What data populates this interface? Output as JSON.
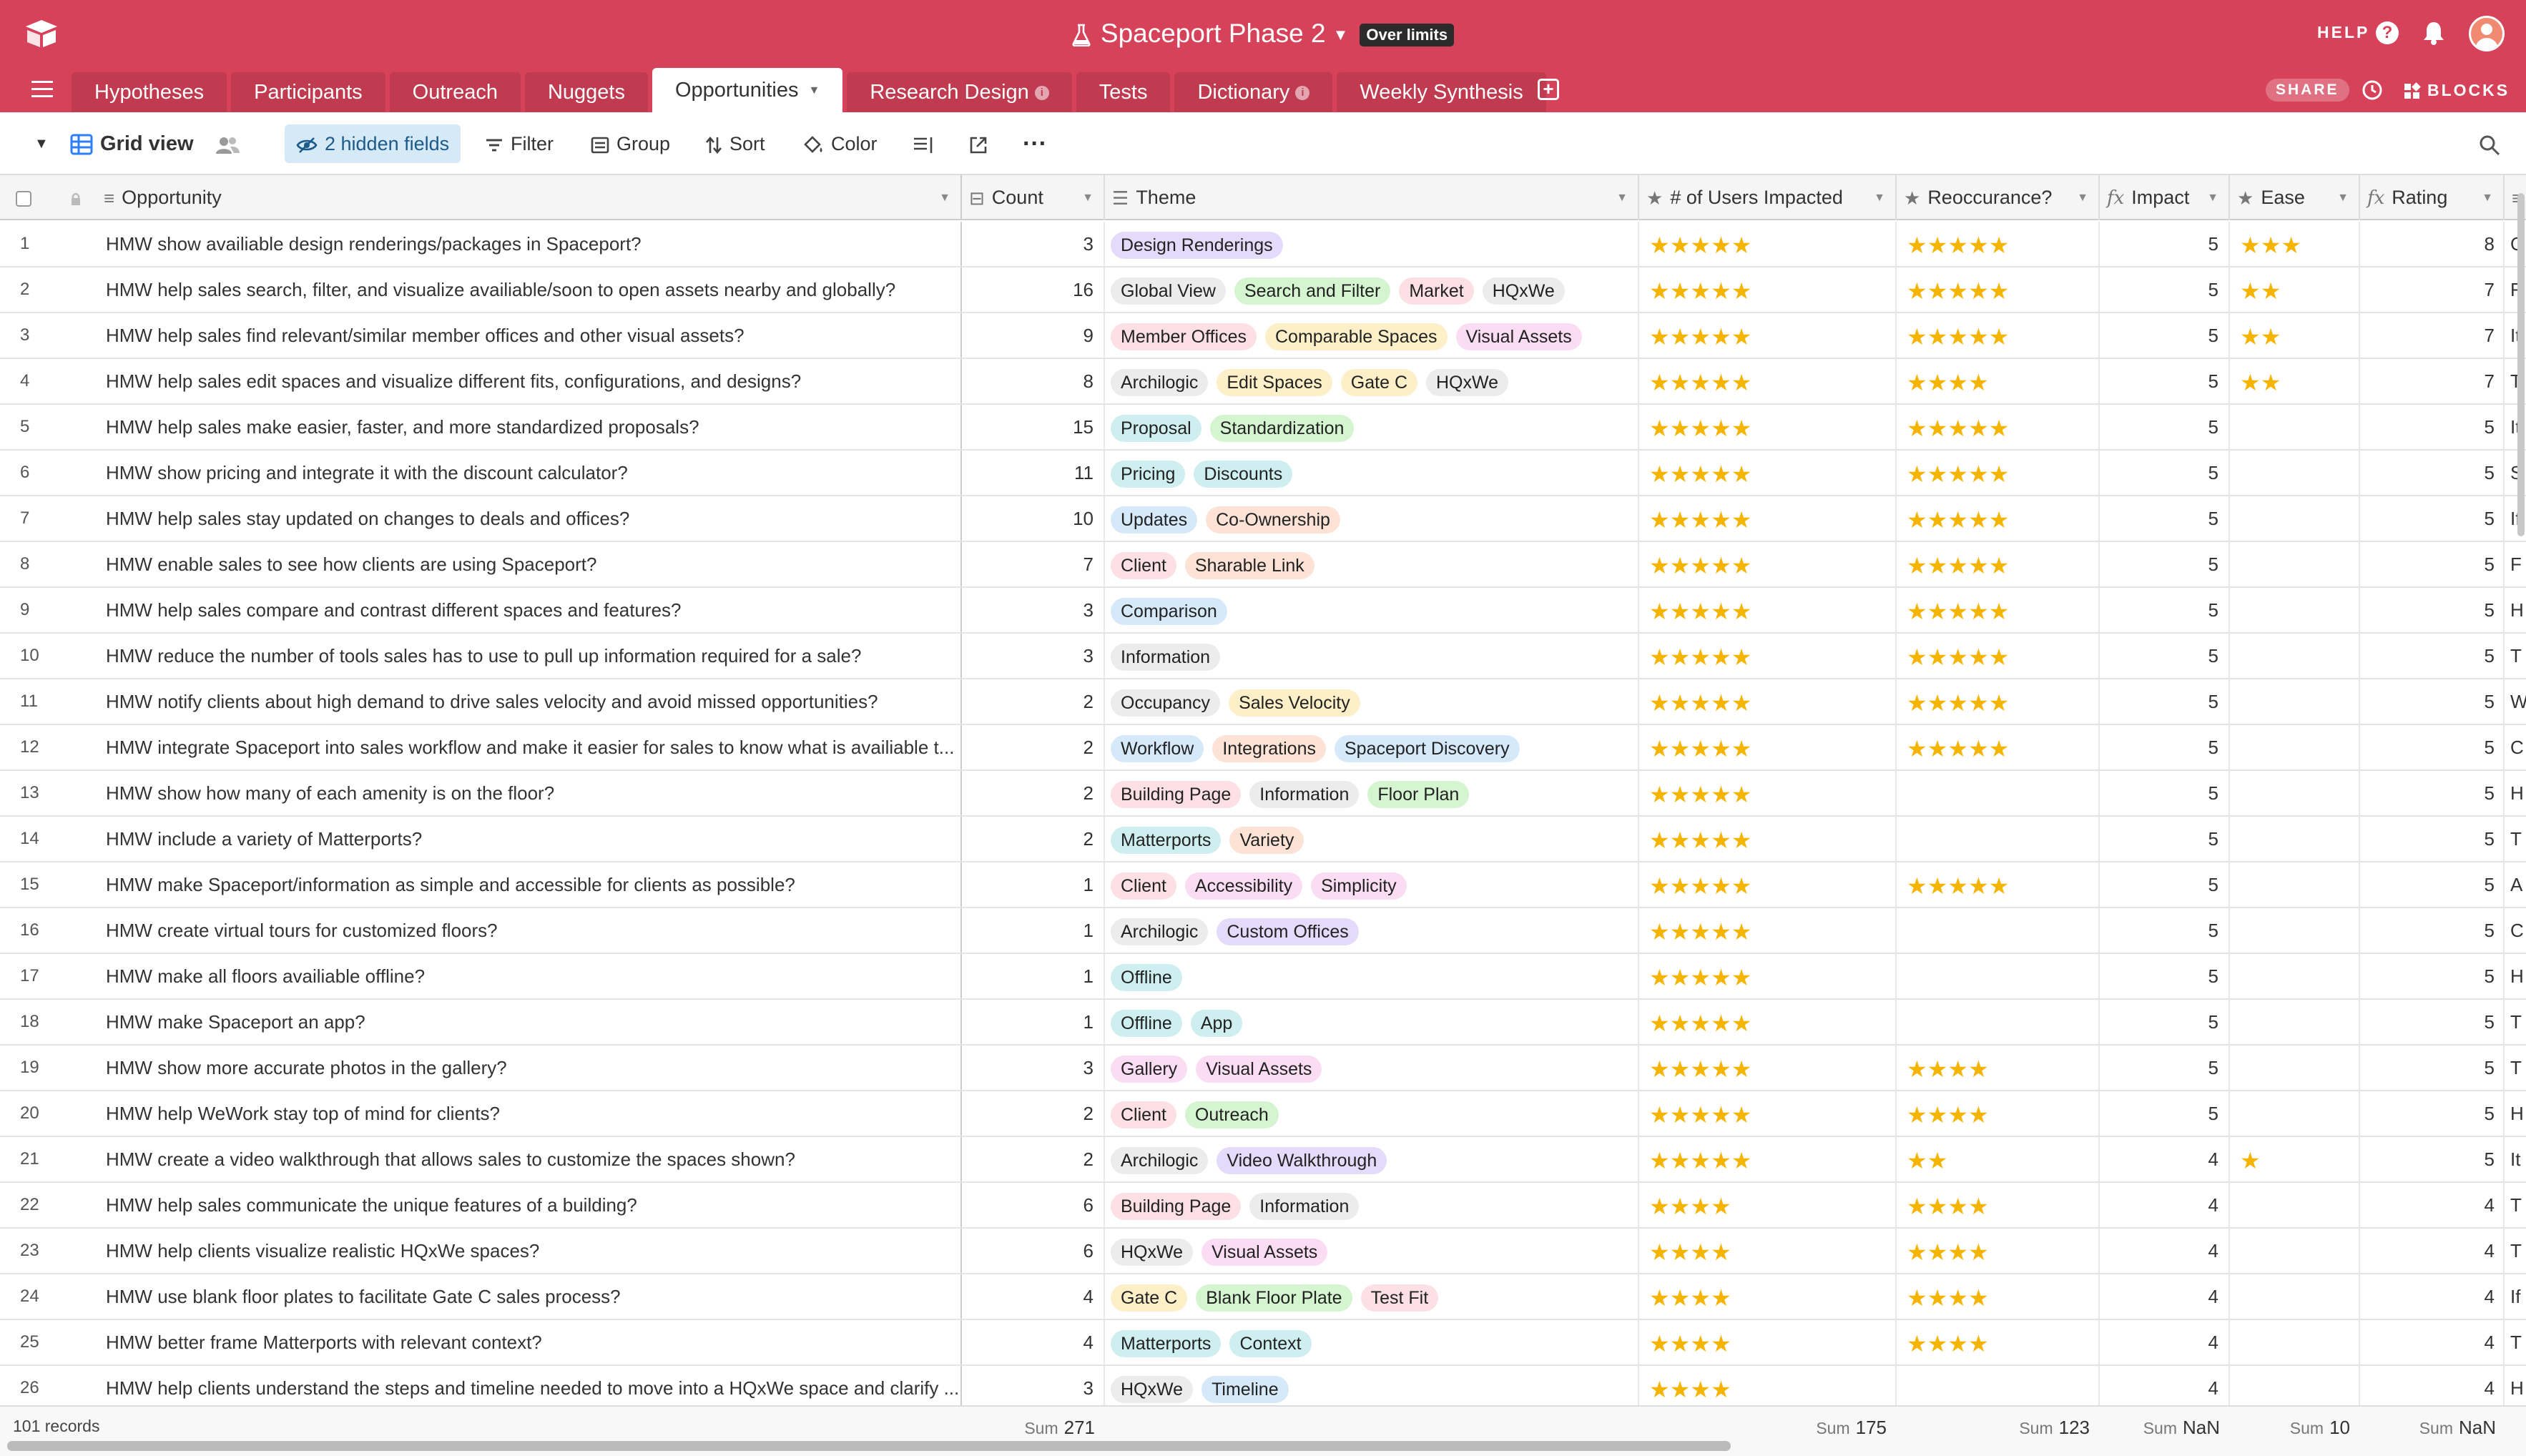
{
  "header": {
    "base_title": "Spaceport Phase 2",
    "badge": "Over limits",
    "help_label": "HELP"
  },
  "tabs": [
    {
      "label": "Hypotheses",
      "info": false
    },
    {
      "label": "Participants",
      "info": false
    },
    {
      "label": "Outreach",
      "info": false
    },
    {
      "label": "Nuggets",
      "info": false
    },
    {
      "label": "Opportunities",
      "info": false,
      "active": true
    },
    {
      "label": "Research Design",
      "info": true
    },
    {
      "label": "Tests",
      "info": false
    },
    {
      "label": "Dictionary",
      "info": true
    },
    {
      "label": "Weekly Synthesis",
      "info": false
    }
  ],
  "tabbar": {
    "share_label": "SHARE",
    "blocks_label": "BLOCKS"
  },
  "toolbar": {
    "view_name": "Grid view",
    "hidden_fields": "2 hidden fields",
    "filter": "Filter",
    "group": "Group",
    "sort": "Sort",
    "color": "Color",
    "more": "···"
  },
  "columns": {
    "opportunity": "Opportunity",
    "count": "Count",
    "theme": "Theme",
    "users": "# of Users Impacted",
    "reoccurance": "Reoccurance?",
    "impact": "Impact",
    "ease": "Ease",
    "rating": "Rating"
  },
  "tag_colors": {
    "Design Renderings": "#e4dbfb",
    "Global View": "#ececec",
    "Search and Filter": "#d4f5d0",
    "Market": "#fde0e5",
    "HQxWe": "#ececec",
    "Member Offices": "#fde0e5",
    "Comparable Spaces": "#fdefc8",
    "Visual Assets": "#fadcf3",
    "Archilogic": "#ececec",
    "Edit Spaces": "#fdefc8",
    "Gate C": "#fdefc8",
    "Proposal": "#cfeef0",
    "Standardization": "#d4f5d0",
    "Pricing": "#cfeef0",
    "Discounts": "#cfeef0",
    "Updates": "#d6e9fb",
    "Co-Ownership": "#fde3d6",
    "Client": "#fde0e5",
    "Sharable Link": "#fde3d6",
    "Comparison": "#d6e9fb",
    "Information": "#ececec",
    "Occupancy": "#ececec",
    "Sales Velocity": "#fdefc8",
    "Workflow": "#d6e9fb",
    "Integrations": "#fde3d6",
    "Spaceport Discovery": "#d6e9fb",
    "Building Page": "#fde0e5",
    "Floor Plan": "#d4f5d0",
    "Matterports": "#cfeef0",
    "Variety": "#fde3d6",
    "Accessibility": "#fadcf3",
    "Simplicity": "#fadcf3",
    "Custom Offices": "#e4dbfb",
    "Offline": "#cfeef0",
    "App": "#cfeef0",
    "Gallery": "#fadcf3",
    "Outreach": "#d4f5d0",
    "Video Walkthrough": "#e4dbfb",
    "Blank Floor Plate": "#d4f5d0",
    "Test Fit": "#fde0e5",
    "Context": "#cfeef0",
    "Timeline": "#d6e9fb"
  },
  "rows": [
    {
      "n": "1",
      "opp": "HMW show availiable design renderings/packages in Spaceport?",
      "count": "3",
      "tags": [
        "Design Renderings"
      ],
      "users": 5,
      "reocc": 5,
      "impact": "5",
      "ease": 3,
      "rating": "8",
      "extra": "C"
    },
    {
      "n": "2",
      "opp": "HMW help sales search, filter, and visualize availiable/soon to open assets nearby and globally?",
      "count": "16",
      "tags": [
        "Global View",
        "Search and Filter",
        "Market",
        "HQxWe"
      ],
      "users": 5,
      "reocc": 5,
      "impact": "5",
      "ease": 2,
      "rating": "7",
      "extra": "F"
    },
    {
      "n": "3",
      "opp": "HMW help sales find relevant/similar member offices and other visual assets?",
      "count": "9",
      "tags": [
        "Member Offices",
        "Comparable Spaces",
        "Visual Assets"
      ],
      "users": 5,
      "reocc": 5,
      "impact": "5",
      "ease": 2,
      "rating": "7",
      "extra": "It"
    },
    {
      "n": "4",
      "opp": "HMW help sales edit spaces and visualize different fits, configurations, and designs?",
      "count": "8",
      "tags": [
        "Archilogic",
        "Edit Spaces",
        "Gate C",
        "HQxWe"
      ],
      "users": 5,
      "reocc": 4,
      "impact": "5",
      "ease": 2,
      "rating": "7",
      "extra": "T"
    },
    {
      "n": "5",
      "opp": "HMW help sales make easier, faster, and more standardized proposals?",
      "count": "15",
      "tags": [
        "Proposal",
        "Standardization"
      ],
      "users": 5,
      "reocc": 5,
      "impact": "5",
      "ease": 0,
      "rating": "5",
      "extra": "It"
    },
    {
      "n": "6",
      "opp": "HMW show pricing and integrate it with the discount calculator?",
      "count": "11",
      "tags": [
        "Pricing",
        "Discounts"
      ],
      "users": 5,
      "reocc": 5,
      "impact": "5",
      "ease": 0,
      "rating": "5",
      "extra": "S"
    },
    {
      "n": "7",
      "opp": "HMW help sales stay updated on changes to deals and offices?",
      "count": "10",
      "tags": [
        "Updates",
        "Co-Ownership"
      ],
      "users": 5,
      "reocc": 5,
      "impact": "5",
      "ease": 0,
      "rating": "5",
      "extra": "If"
    },
    {
      "n": "8",
      "opp": "HMW enable sales to see how clients are using Spaceport?",
      "count": "7",
      "tags": [
        "Client",
        "Sharable Link"
      ],
      "users": 5,
      "reocc": 5,
      "impact": "5",
      "ease": 0,
      "rating": "5",
      "extra": "F"
    },
    {
      "n": "9",
      "opp": "HMW help sales compare and contrast different spaces and features?",
      "count": "3",
      "tags": [
        "Comparison"
      ],
      "users": 5,
      "reocc": 5,
      "impact": "5",
      "ease": 0,
      "rating": "5",
      "extra": "H"
    },
    {
      "n": "10",
      "opp": "HMW reduce the number of tools sales has to use to pull up information required for a sale?",
      "count": "3",
      "tags": [
        "Information"
      ],
      "users": 5,
      "reocc": 5,
      "impact": "5",
      "ease": 0,
      "rating": "5",
      "extra": "T"
    },
    {
      "n": "11",
      "opp": "HMW notify clients about high demand to drive sales velocity and avoid missed opportunities?",
      "count": "2",
      "tags": [
        "Occupancy",
        "Sales Velocity"
      ],
      "users": 5,
      "reocc": 5,
      "impact": "5",
      "ease": 0,
      "rating": "5",
      "extra": "W"
    },
    {
      "n": "12",
      "opp": "HMW integrate Spaceport into sales workflow and make it easier for sales to know what is availiable t...",
      "count": "2",
      "tags": [
        "Workflow",
        "Integrations",
        "Spaceport Discovery"
      ],
      "users": 5,
      "reocc": 5,
      "impact": "5",
      "ease": 0,
      "rating": "5",
      "extra": "C"
    },
    {
      "n": "13",
      "opp": "HMW show how many of each amenity is on the floor?",
      "count": "2",
      "tags": [
        "Building Page",
        "Information",
        "Floor Plan"
      ],
      "users": 5,
      "reocc": 0,
      "impact": "5",
      "ease": 0,
      "rating": "5",
      "extra": "H"
    },
    {
      "n": "14",
      "opp": "HMW include a variety of Matterports?",
      "count": "2",
      "tags": [
        "Matterports",
        "Variety"
      ],
      "users": 5,
      "reocc": 0,
      "impact": "5",
      "ease": 0,
      "rating": "5",
      "extra": "T"
    },
    {
      "n": "15",
      "opp": "HMW make Spaceport/information as simple and accessible for clients as possible?",
      "count": "1",
      "tags": [
        "Client",
        "Accessibility",
        "Simplicity"
      ],
      "users": 5,
      "reocc": 5,
      "impact": "5",
      "ease": 0,
      "rating": "5",
      "extra": "A"
    },
    {
      "n": "16",
      "opp": "HMW create virtual tours for customized floors?",
      "count": "1",
      "tags": [
        "Archilogic",
        "Custom Offices"
      ],
      "users": 5,
      "reocc": 0,
      "impact": "5",
      "ease": 0,
      "rating": "5",
      "extra": "C"
    },
    {
      "n": "17",
      "opp": "HMW make all floors availiable offline?",
      "count": "1",
      "tags": [
        "Offline"
      ],
      "users": 5,
      "reocc": 0,
      "impact": "5",
      "ease": 0,
      "rating": "5",
      "extra": "H"
    },
    {
      "n": "18",
      "opp": "HMW make Spaceport an app?",
      "count": "1",
      "tags": [
        "Offline",
        "App"
      ],
      "users": 5,
      "reocc": 0,
      "impact": "5",
      "ease": 0,
      "rating": "5",
      "extra": "T"
    },
    {
      "n": "19",
      "opp": "HMW show more accurate photos in the gallery?",
      "count": "3",
      "tags": [
        "Gallery",
        "Visual Assets"
      ],
      "users": 5,
      "reocc": 4,
      "impact": "5",
      "ease": 0,
      "rating": "5",
      "extra": "T"
    },
    {
      "n": "20",
      "opp": "HMW help WeWork stay top of mind for clients?",
      "count": "2",
      "tags": [
        "Client",
        "Outreach"
      ],
      "users": 5,
      "reocc": 4,
      "impact": "5",
      "ease": 0,
      "rating": "5",
      "extra": "H"
    },
    {
      "n": "21",
      "opp": "HMW create a video walkthrough that allows sales to customize the spaces shown?",
      "count": "2",
      "tags": [
        "Archilogic",
        "Video Walkthrough"
      ],
      "users": 5,
      "reocc": 2,
      "impact": "4",
      "ease": 1,
      "rating": "5",
      "extra": "It"
    },
    {
      "n": "22",
      "opp": "HMW help sales communicate the unique features of a building?",
      "count": "6",
      "tags": [
        "Building Page",
        "Information"
      ],
      "users": 4,
      "reocc": 4,
      "impact": "4",
      "ease": 0,
      "rating": "4",
      "extra": "T"
    },
    {
      "n": "23",
      "opp": "HMW help clients visualize realistic HQxWe spaces?",
      "count": "6",
      "tags": [
        "HQxWe",
        "Visual Assets"
      ],
      "users": 4,
      "reocc": 4,
      "impact": "4",
      "ease": 0,
      "rating": "4",
      "extra": "T"
    },
    {
      "n": "24",
      "opp": "HMW use blank floor plates to facilitate Gate C sales process?",
      "count": "4",
      "tags": [
        "Gate C",
        "Blank Floor Plate",
        "Test Fit"
      ],
      "users": 4,
      "reocc": 4,
      "impact": "4",
      "ease": 0,
      "rating": "4",
      "extra": "If"
    },
    {
      "n": "25",
      "opp": "HMW better frame Matterports with relevant context?",
      "count": "4",
      "tags": [
        "Matterports",
        "Context"
      ],
      "users": 4,
      "reocc": 4,
      "impact": "4",
      "ease": 0,
      "rating": "4",
      "extra": "T"
    },
    {
      "n": "26",
      "opp": "HMW help clients understand the steps and timeline needed to move into a HQxWe space and clarify ...",
      "count": "3",
      "tags": [
        "HQxWe",
        "Timeline"
      ],
      "users": 4,
      "reocc": 0,
      "impact": "4",
      "ease": 0,
      "rating": "4",
      "extra": "H"
    }
  ],
  "footer": {
    "records": "101 records",
    "sum_label": "Sum",
    "sum_count": "271",
    "sum_users": "175",
    "sum_reocc": "123",
    "sum_impact": "NaN",
    "sum_ease": "10",
    "sum_rating": "NaN"
  },
  "star_color": "#f4b400",
  "brand_color": "#d54259"
}
